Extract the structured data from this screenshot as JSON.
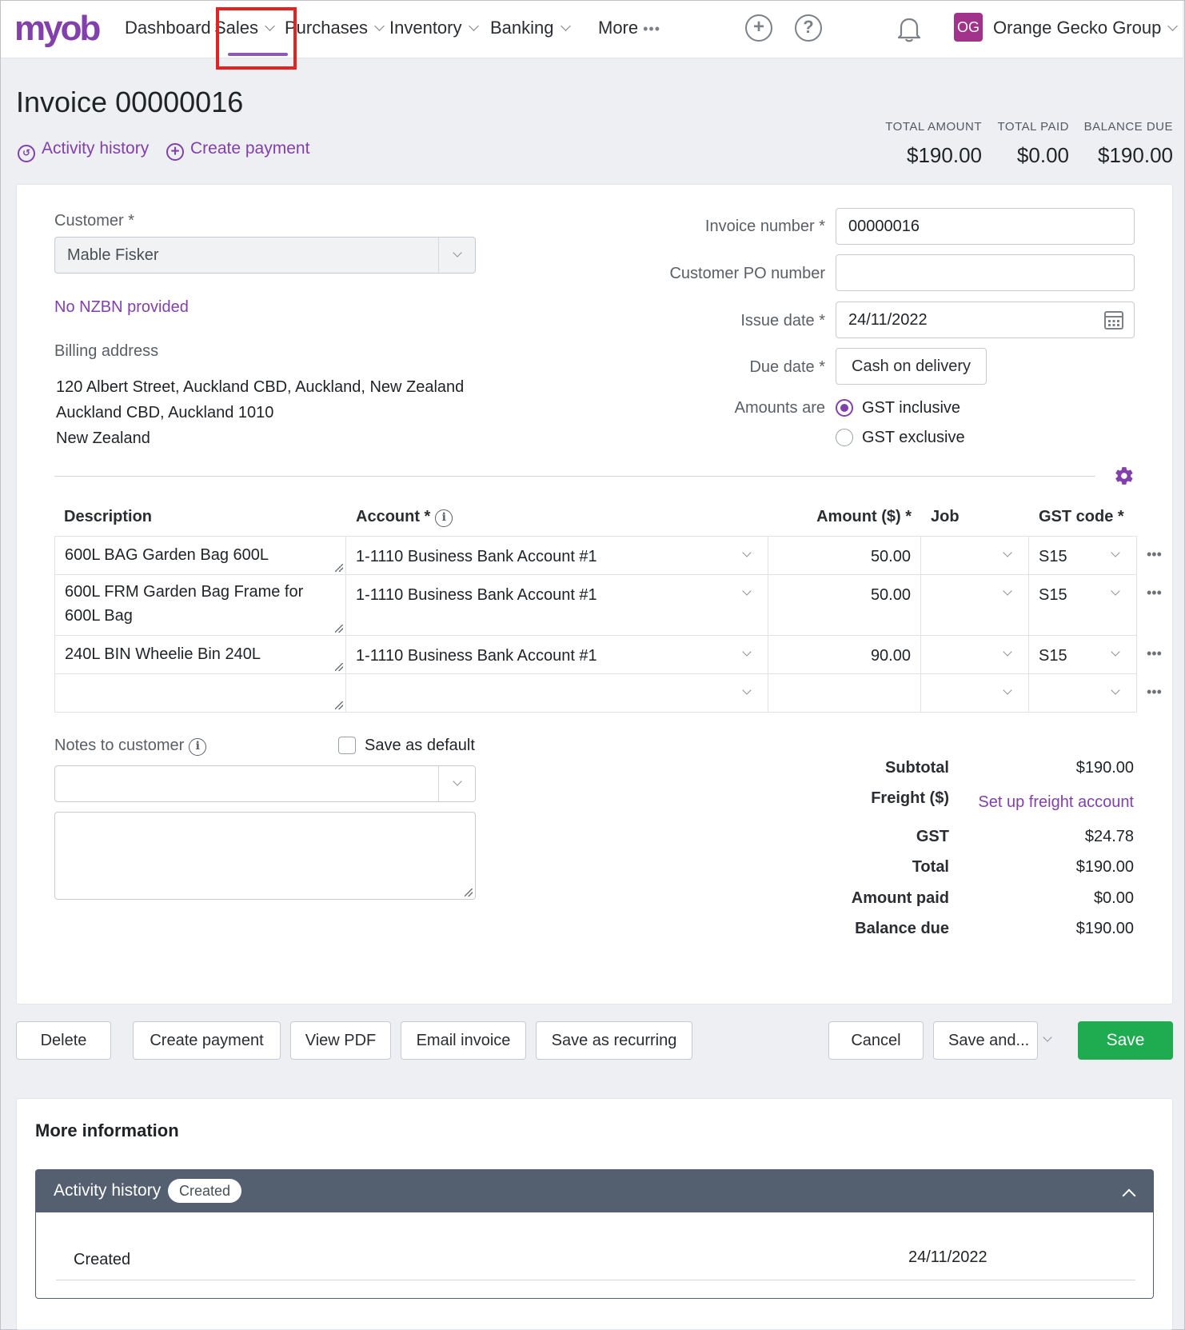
{
  "nav": {
    "logo": "myob",
    "items": [
      "Dashboard",
      "Sales",
      "Purchases",
      "Inventory",
      "Banking"
    ],
    "more": "More",
    "more_dots": "•••",
    "add_icon": "plus-circle-icon",
    "help_icon": "question-circle-icon",
    "bell_icon": "bell-icon",
    "avatar": "OG",
    "org": "Orange Gecko Group",
    "highlight_color": "#e32322",
    "brand_color": "#8241aa"
  },
  "header": {
    "title": "Invoice 00000016",
    "activity_history": "Activity history",
    "create_payment": "Create payment",
    "total_amount_label": "TOTAL AMOUNT",
    "total_amount": "$190.00",
    "total_paid_label": "TOTAL PAID",
    "total_paid": "$0.00",
    "balance_due_label": "BALANCE DUE",
    "balance_due": "$190.00"
  },
  "form": {
    "customer_label": "Customer *",
    "customer_value": "Mable Fisker",
    "nzbn": "No NZBN provided",
    "billing_label": "Billing address",
    "billing_lines": [
      "120 Albert Street, Auckland CBD, Auckland, New Zealand",
      "Auckland CBD, Auckland 1010",
      "New Zealand"
    ],
    "invoice_number_label": "Invoice number *",
    "invoice_number": "00000016",
    "po_label": "Customer PO number",
    "po_value": "",
    "issue_date_label": "Issue date *",
    "issue_date": "24/11/2022",
    "due_date_label": "Due date *",
    "due_date": "Cash on delivery",
    "amounts_label": "Amounts are",
    "gst_inclusive": "GST inclusive",
    "gst_exclusive": "GST exclusive",
    "amounts_selected": "GST inclusive"
  },
  "table": {
    "headers": {
      "description": "Description",
      "account": "Account *",
      "amount": "Amount ($) *",
      "job": "Job",
      "gst": "GST code *"
    },
    "rows": [
      {
        "description": "600L BAG Garden Bag 600L",
        "account": "1-1110  Business Bank Account #1",
        "amount": "50.00",
        "job": "",
        "gst": "S15"
      },
      {
        "description": "600L FRM Garden Bag Frame for 600L Bag",
        "account": "1-1110  Business Bank Account #1",
        "amount": "50.00",
        "job": "",
        "gst": "S15"
      },
      {
        "description": "240L BIN  Wheelie Bin 240L",
        "account": "1-1110  Business Bank Account #1",
        "amount": "90.00",
        "job": "",
        "gst": "S15"
      },
      {
        "description": "",
        "account": "",
        "amount": "",
        "job": "",
        "gst": ""
      }
    ]
  },
  "notes": {
    "label": "Notes to customer",
    "save_default": "Save as default",
    "value": ""
  },
  "summary": {
    "subtotal_label": "Subtotal",
    "subtotal": "$190.00",
    "freight_label": "Freight ($)",
    "freight_link": "Set up freight account",
    "gst_label": "GST",
    "gst": "$24.78",
    "total_label": "Total",
    "total": "$190.00",
    "paid_label": "Amount paid",
    "paid": "$0.00",
    "balance_label": "Balance due",
    "balance": "$190.00"
  },
  "actions": {
    "delete": "Delete",
    "create_payment": "Create payment",
    "view_pdf": "View PDF",
    "email_invoice": "Email invoice",
    "save_recurring": "Save as recurring",
    "cancel": "Cancel",
    "save_and": "Save and...",
    "save": "Save",
    "save_color": "#1fab4f"
  },
  "more_info": {
    "title": "More information",
    "accordion_title": "Activity history",
    "badge": "Created",
    "entry_label": "Created",
    "entry_date": "24/11/2022"
  }
}
